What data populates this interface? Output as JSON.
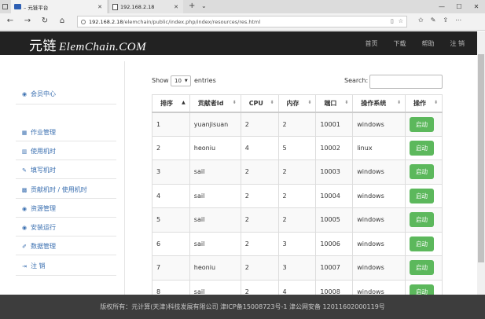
{
  "browser": {
    "tabs": [
      {
        "title": "– 元链平台",
        "active": true
      },
      {
        "title": "192.168.2.18",
        "active": false
      }
    ],
    "url_host": "192.168.2.18",
    "url_path": "/elemchain/public/index.php/index/resources/res.html"
  },
  "header": {
    "logo_cn": "元链",
    "logo_en": "ElemChain.COM",
    "nav": [
      "首页",
      "下载",
      "帮助",
      "注 销"
    ]
  },
  "sidebar": {
    "member_center": "会员中心",
    "items": [
      "作业管理",
      "使用机时",
      "填写机时",
      "贡献机时 / 使用机时",
      "资源管理",
      "安装运行",
      "数据管理",
      "注 销"
    ]
  },
  "controls": {
    "show_label": "Show",
    "page_size": "10",
    "entries_label": "entries",
    "search_label": "Search:"
  },
  "table": {
    "columns": [
      "排序",
      "贡献者Id",
      "CPU",
      "内存",
      "端口",
      "操作系统",
      "操作"
    ],
    "rows": [
      [
        "1",
        "yuanjisuan",
        "2",
        "2",
        "10001",
        "windows",
        "启动"
      ],
      [
        "2",
        "heoniu",
        "4",
        "5",
        "10002",
        "linux",
        "启动"
      ],
      [
        "3",
        "sail",
        "2",
        "2",
        "10003",
        "windows",
        "启动"
      ],
      [
        "4",
        "sail",
        "2",
        "2",
        "10004",
        "windows",
        "启动"
      ],
      [
        "5",
        "sail",
        "2",
        "2",
        "10005",
        "windows",
        "启动"
      ],
      [
        "6",
        "sail",
        "2",
        "3",
        "10006",
        "windows",
        "启动"
      ],
      [
        "7",
        "heoniu",
        "2",
        "3",
        "10007",
        "windows",
        "启动"
      ],
      [
        "8",
        "sail",
        "2",
        "4",
        "10008",
        "windows",
        "启动"
      ]
    ]
  },
  "footer": {
    "text": "版权所有：元计算(天津)科技发展有限公司 津ICP备15008723号-1 津公网安备 12011602000119号"
  },
  "colors": {
    "header_bg": "#222222",
    "footer_bg": "#3d3d3d",
    "link_blue": "#3a6fb0",
    "button_green": "#5cb85c"
  }
}
